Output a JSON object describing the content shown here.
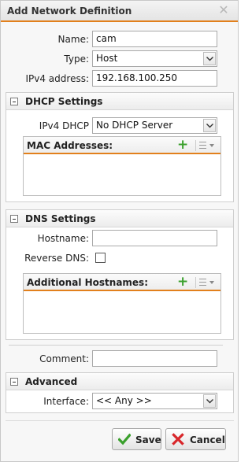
{
  "dialog": {
    "title": "Add Network Definition",
    "close_glyph": "✕"
  },
  "fields": {
    "name": {
      "label": "Name:",
      "value": "cam"
    },
    "type": {
      "label": "Type:",
      "value": "Host"
    },
    "ipv4": {
      "label": "IPv4 address:",
      "value": "192.168.100.250"
    }
  },
  "dhcp": {
    "title": "DHCP Settings",
    "ipv4_dhcp": {
      "label": "IPv4 DHCP",
      "value": "No DHCP Server"
    },
    "mac_grid": {
      "title": "MAC Addresses:",
      "add_icon": "plus-icon",
      "menu_icon": "list-menu-icon"
    }
  },
  "dns": {
    "title": "DNS Settings",
    "hostname": {
      "label": "Hostname:",
      "value": ""
    },
    "reverse_dns": {
      "label": "Reverse DNS:",
      "checked": false
    },
    "hosts_grid": {
      "title": "Additional Hostnames:",
      "add_icon": "plus-icon",
      "menu_icon": "list-menu-icon"
    }
  },
  "comment": {
    "label": "Comment:",
    "value": ""
  },
  "advanced": {
    "title": "Advanced",
    "interface": {
      "label": "Interface:",
      "value": "<< Any >>"
    }
  },
  "buttons": {
    "save": {
      "label": "Save",
      "icon": "check-icon"
    },
    "cancel": {
      "label": "Cancel",
      "icon": "x-icon"
    }
  },
  "colors": {
    "accent": "#e2801c",
    "save_icon": "#3aa02c",
    "cancel_icon": "#d8262a",
    "add_icon": "#3aa02c"
  }
}
